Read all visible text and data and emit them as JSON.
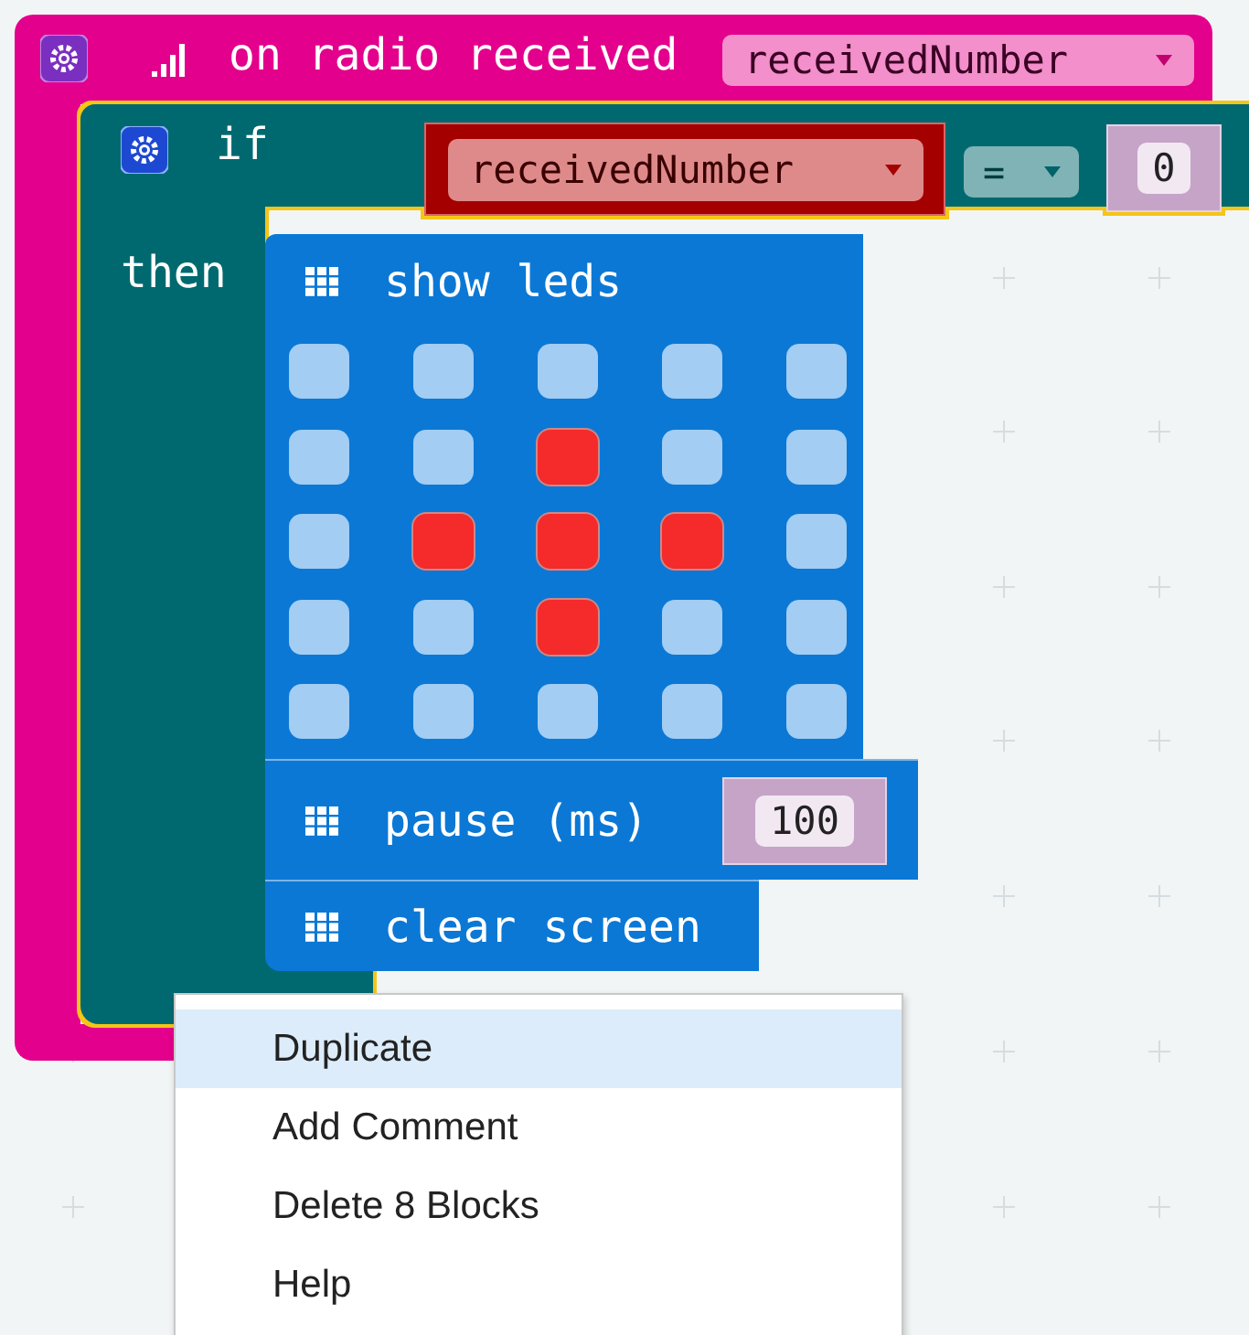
{
  "event_block": {
    "label": "on radio received",
    "parameter": "receivedNumber"
  },
  "if_block": {
    "label": "if",
    "then_label": "then",
    "selected": true,
    "condition": {
      "variable": "receivedNumber",
      "operator": "=",
      "value": "0"
    }
  },
  "show_leds": {
    "label": "show leds",
    "leds": [
      [
        false,
        false,
        false,
        false,
        false
      ],
      [
        false,
        false,
        true,
        false,
        false
      ],
      [
        false,
        true,
        true,
        true,
        false
      ],
      [
        false,
        false,
        true,
        false,
        false
      ],
      [
        false,
        false,
        false,
        false,
        false
      ]
    ]
  },
  "pause": {
    "label": "pause (ms)",
    "value": "100"
  },
  "clear_screen": {
    "label": "clear screen"
  },
  "context_menu": [
    {
      "label": "Duplicate",
      "selected": true
    },
    {
      "label": "Add Comment",
      "selected": false
    },
    {
      "label": "Delete 8 Blocks",
      "selected": false
    },
    {
      "label": "Help",
      "selected": false
    }
  ]
}
